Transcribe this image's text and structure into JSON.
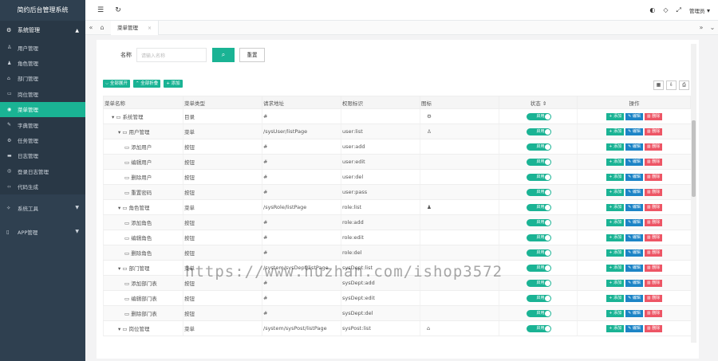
{
  "app_title": "简约后台管理系统",
  "sidebar": {
    "group1": "系统管理",
    "items": [
      "用户管理",
      "角色管理",
      "部门管理",
      "岗位管理",
      "菜单管理",
      "字典管理",
      "任务管理",
      "日志管理",
      "登录日志管理",
      "代码生成"
    ],
    "group2": "系统工具",
    "group3": "APP管理"
  },
  "header": {
    "user": "管理员"
  },
  "tab": {
    "label": "菜单管理"
  },
  "search": {
    "label": "名称",
    "placeholder": "请输入名称",
    "reset": "重置"
  },
  "toolbar": {
    "expand": "全部展开",
    "collapse": "全部折叠",
    "add": "添加"
  },
  "table": {
    "headers": [
      "菜单名称",
      "菜单类型",
      "请求地址",
      "权限标识",
      "图标",
      "状态",
      "操作"
    ],
    "status": "启用",
    "ops": {
      "add": "添加",
      "edit": "编辑",
      "del": "删除"
    },
    "rows": [
      {
        "name": "系统管理",
        "type": "目录",
        "url": "#",
        "perm": "",
        "icon": "gear-icon",
        "level": 0
      },
      {
        "name": "用户管理",
        "type": "菜单",
        "url": "/sysUser/listPage",
        "perm": "user:list",
        "icon": "user-icon",
        "level": 1
      },
      {
        "name": "添加用户",
        "type": "按钮",
        "url": "#",
        "perm": "user:add",
        "icon": "",
        "level": 2
      },
      {
        "name": "编辑用户",
        "type": "按钮",
        "url": "#",
        "perm": "user:edit",
        "icon": "",
        "level": 2
      },
      {
        "name": "删除用户",
        "type": "按钮",
        "url": "#",
        "perm": "user:del",
        "icon": "",
        "level": 2
      },
      {
        "name": "重置密码",
        "type": "按钮",
        "url": "#",
        "perm": "user:pass",
        "icon": "",
        "level": 2
      },
      {
        "name": "角色管理",
        "type": "菜单",
        "url": "/sysRole/listPage",
        "perm": "role:list",
        "icon": "users-icon",
        "level": 1
      },
      {
        "name": "添加角色",
        "type": "按钮",
        "url": "#",
        "perm": "role:add",
        "icon": "",
        "level": 2
      },
      {
        "name": "编辑角色",
        "type": "按钮",
        "url": "#",
        "perm": "role:edit",
        "icon": "",
        "level": 2
      },
      {
        "name": "删除角色",
        "type": "按钮",
        "url": "#",
        "perm": "role:del",
        "icon": "",
        "level": 2
      },
      {
        "name": "部门管理",
        "type": "菜单",
        "url": "/system/sysDept/listPage",
        "perm": "sysDept:list",
        "icon": "",
        "level": 1
      },
      {
        "name": "添加部门表",
        "type": "按钮",
        "url": "#",
        "perm": "sysDept:add",
        "icon": "",
        "level": 2
      },
      {
        "name": "编辑部门表",
        "type": "按钮",
        "url": "#",
        "perm": "sysDept:edit",
        "icon": "",
        "level": 2
      },
      {
        "name": "删除部门表",
        "type": "按钮",
        "url": "#",
        "perm": "sysDept:del",
        "icon": "",
        "level": 2
      },
      {
        "name": "岗位管理",
        "type": "菜单",
        "url": "/system/sysPost/listPage",
        "perm": "sysPost:list",
        "icon": "home-icon",
        "level": 1
      }
    ]
  },
  "watermark": "https://www.huzhan.com/ishop3572"
}
